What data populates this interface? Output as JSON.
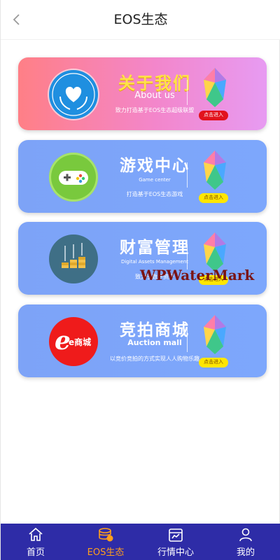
{
  "header": {
    "title": "EOS生态",
    "back_icon": "chevron-left-icon"
  },
  "cards": [
    {
      "title": "关于我们",
      "subtitle": "About us",
      "desc": "致力打造基于EOS生态超级联盟",
      "enter": "点击进入",
      "logo_icon": "heart-laurel-logo-icon",
      "enter_color": "#e2121d"
    },
    {
      "title": "游戏中心",
      "subtitle": "Game center",
      "desc": "打造基于EOS生态游戏",
      "enter": "点击进入",
      "logo_icon": "gamepad-logo-icon",
      "enter_color": "#ffe600"
    },
    {
      "title": "财富管理",
      "subtitle": "Digital Assets Management",
      "desc": "致力于数字资产",
      "enter": "点击进入",
      "logo_icon": "coins-logo-icon",
      "enter_color": "#ffe600"
    },
    {
      "title": "竞拍商城",
      "subtitle": "Auction mall",
      "desc": "以竞价竞拍的方式实现人人购物乐趣",
      "enter": "点击进入",
      "logo_icon": "e-mall-logo-icon",
      "logo_text": "e商城",
      "enter_color": "#ffe600"
    }
  ],
  "watermark": "WPWaterMark",
  "tabbar": {
    "active_color": "#ff9f1c",
    "background": "#2e2ca7",
    "items": [
      {
        "label": "首页",
        "icon": "home-icon"
      },
      {
        "label": "EOS生态",
        "icon": "coins-stack-icon",
        "active": true
      },
      {
        "label": "行情中心",
        "icon": "market-chart-icon"
      },
      {
        "label": "我的",
        "icon": "user-icon"
      }
    ]
  }
}
